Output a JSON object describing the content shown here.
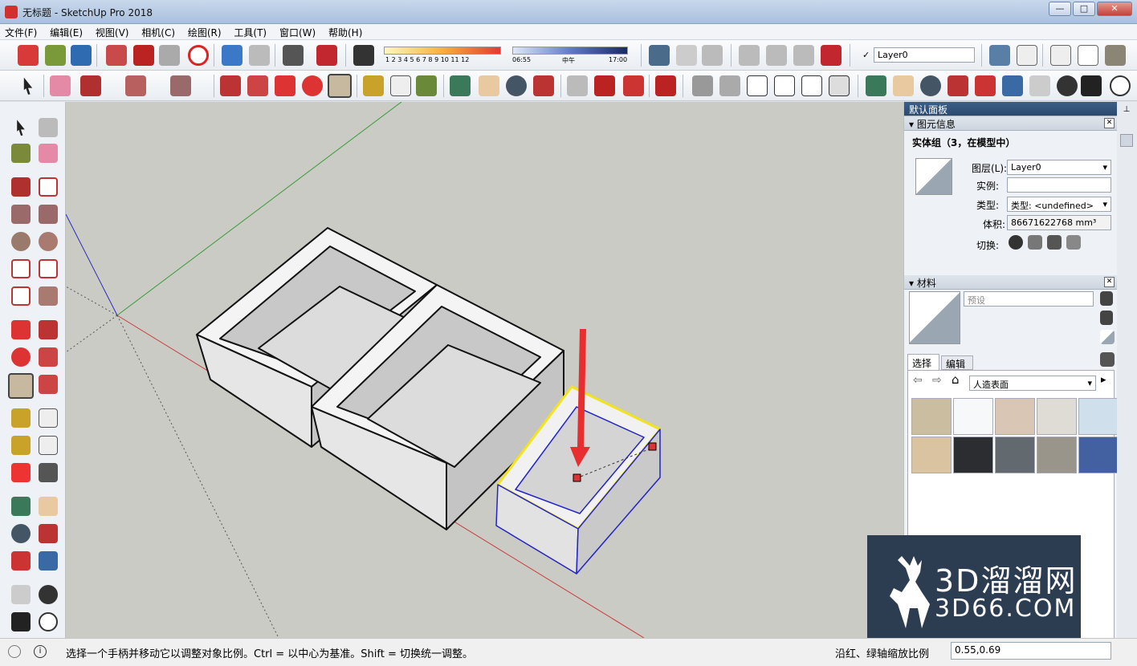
{
  "window": {
    "title": "无标题 - SketchUp Pro 2018",
    "min": "—",
    "max": "□",
    "close": "✕"
  },
  "menu": [
    "文件(F)",
    "编辑(E)",
    "视图(V)",
    "相机(C)",
    "绘图(R)",
    "工具(T)",
    "窗口(W)",
    "帮助(H)"
  ],
  "toolbar": {
    "shadow_scale": "1 2 3 4 5 6 7 8 9 10 11 12",
    "time_start": "06:55",
    "time_mid": "中午",
    "time_end": "17:00",
    "layer_check": "✓",
    "layer_value": "Layer0"
  },
  "tray": {
    "title": "默认面板",
    "entity_info": {
      "header": "图元信息",
      "selection": "实体组（3，在模型中）",
      "layer_label": "图层(L):",
      "layer_value": "Layer0",
      "instance_label": "实例:",
      "instance_value": "",
      "type_label": "类型:",
      "type_value": "类型: <undefined>",
      "volume_label": "体积:",
      "volume_value": "86671622768 mm³",
      "toggle_label": "切换:"
    },
    "materials": {
      "header": "材料",
      "preset_placeholder": "预设",
      "tab_select": "选择",
      "tab_edit": "编辑",
      "library": "人造表面",
      "swatches": [
        "#cbbd9f",
        "#f7f8f9",
        "#d9c6b4",
        "#dfdcd5",
        "#cfe0ec",
        "#d9c3a0",
        "#2b2d31",
        "#62696f",
        "#99958b",
        "#4361a0"
      ]
    }
  },
  "statusbar": {
    "message": "选择一个手柄并移动它以调整对象比例。Ctrl = 以中心为基准。Shift = 切换统一调整。",
    "vcb_label": "沿红、绿轴缩放比例",
    "vcb_value": "0.55,0.69"
  },
  "watermark": {
    "big": "3D溜溜网",
    "small": "3D66.COM"
  }
}
